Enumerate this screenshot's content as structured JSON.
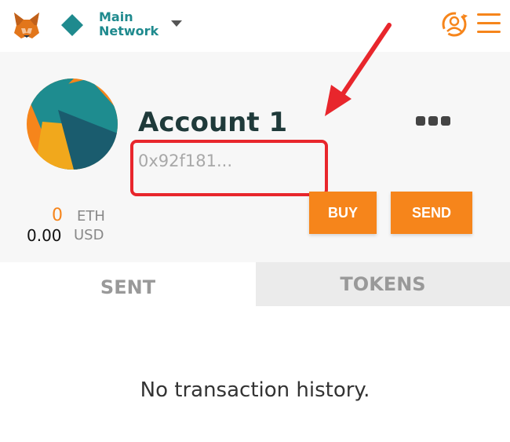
{
  "header": {
    "logo_icon": "metamask-fox-icon",
    "network_icon": "teal-diamond-icon",
    "network_line1": "Main",
    "network_line2": "Network",
    "switch_account_icon": "account-switch-icon",
    "menu_icon": "hamburger-menu-icon"
  },
  "account": {
    "name": "Account 1",
    "address": "0x92f181...",
    "avatar_icon": "account-identicon",
    "options_icon": "more-dots-icon"
  },
  "balance": {
    "eth_value": "0",
    "eth_unit": "ETH",
    "usd_value": "0.00",
    "usd_unit": "USD"
  },
  "actions": {
    "buy_label": "BUY",
    "send_label": "SEND"
  },
  "tabs": {
    "sent_label": "SENT",
    "tokens_label": "TOKENS"
  },
  "transactions": {
    "empty_message": "No transaction history."
  },
  "colors": {
    "accent_orange": "#f6851b",
    "network_teal": "#1f8a8e",
    "annotation_red": "#e8262c"
  }
}
